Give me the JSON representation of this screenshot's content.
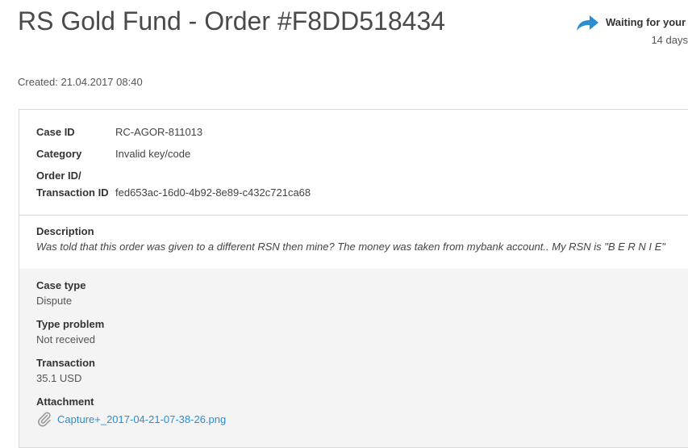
{
  "header": {
    "title": "RS Gold Fund - Order #F8DD518434",
    "created": "Created: 21.04.2017 08:40"
  },
  "status": {
    "icon": "reply-arrow-icon",
    "label": "Waiting for your",
    "sub": "14 days"
  },
  "info": {
    "case_id_label": "Case ID",
    "case_id_value": "RC-AGOR-811013",
    "category_label": "Category",
    "category_value": "Invalid key/code",
    "order_label_line1": "Order ID/",
    "order_label_line2": "Transaction ID",
    "order_value": "fed653ac-16d0-4b92-8e89-c432c721ca68"
  },
  "description": {
    "label": "Description",
    "text": "Was told that this order was given to a different RSN then mine? The money was taken from mybank account.. My RSN is \"B E R N I E\""
  },
  "meta": {
    "case_type_label": "Case type",
    "case_type_value": "Dispute",
    "type_problem_label": "Type problem",
    "type_problem_value": "Not received",
    "transaction_label": "Transaction",
    "transaction_value": "35.1 USD",
    "attachment_label": "Attachment",
    "attachment_file": "Capture+_2017-04-21-07-38-26.png",
    "attachment_icon": "paperclip-icon"
  },
  "colors": {
    "accent": "#2a8ed1",
    "meta_bg": "#f4f4f4",
    "border": "#d9d9d9"
  }
}
